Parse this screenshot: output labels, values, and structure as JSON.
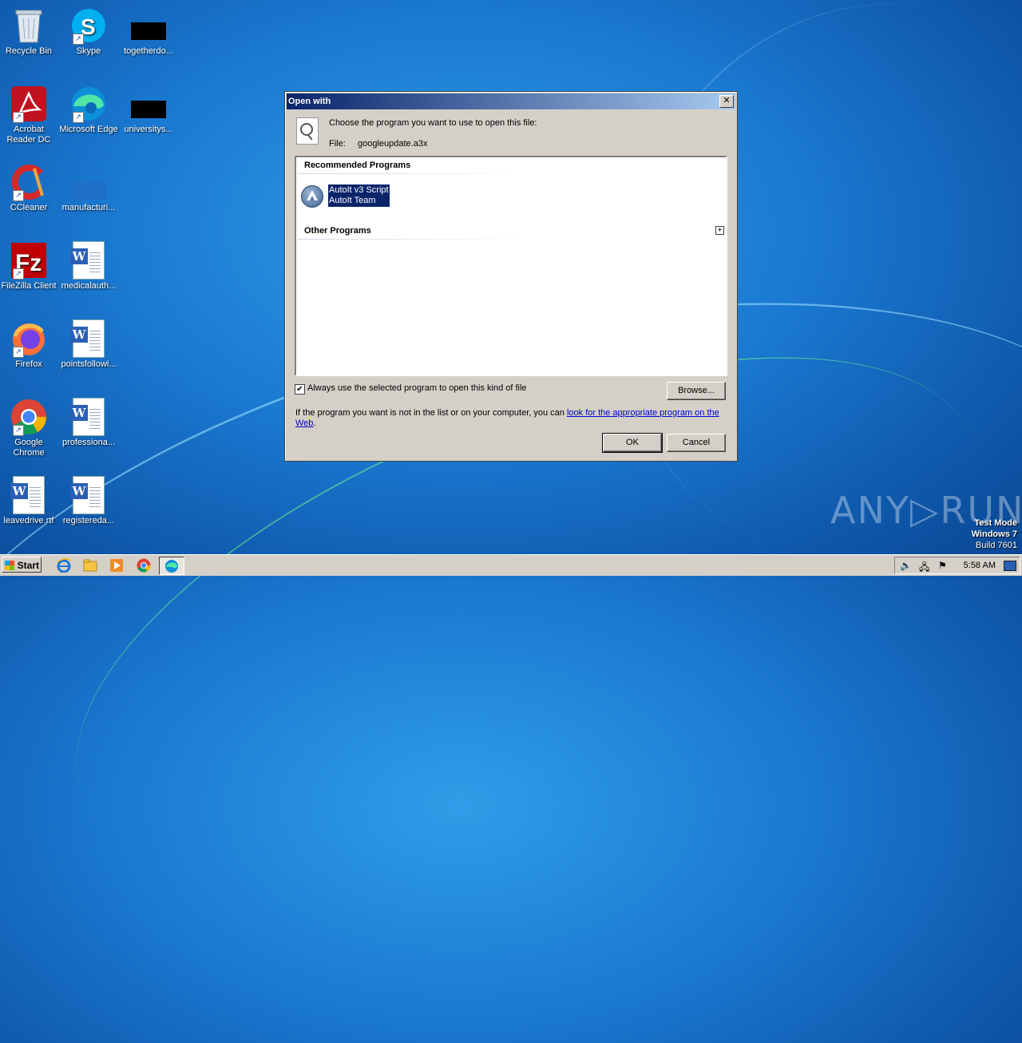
{
  "desktop": {
    "icons": [
      {
        "label": "Recycle Bin"
      },
      {
        "label": "Skype"
      },
      {
        "label": "togetherdo..."
      },
      {
        "label": "Acrobat Reader DC"
      },
      {
        "label": "Microsoft Edge"
      },
      {
        "label": "universitys..."
      },
      {
        "label": "CCleaner"
      },
      {
        "label": "manufacturi..."
      },
      {
        "label": "FileZilla Client"
      },
      {
        "label": "medicalauth..."
      },
      {
        "label": "Firefox"
      },
      {
        "label": "pointsfollowi..."
      },
      {
        "label": "Google Chrome"
      },
      {
        "label": "professiona..."
      },
      {
        "label": "leavedrive.rtf"
      },
      {
        "label": "registereda..."
      }
    ]
  },
  "dialog": {
    "title": "Open with",
    "close_glyph": "✕",
    "prompt": "Choose the program you want to use to open this file:",
    "file_label": "File:",
    "file_name": "googleupdate.a3x",
    "recommended_header": "Recommended Programs",
    "program_name": "AutoIt v3 Script",
    "program_vendor": "AutoIt Team",
    "other_header": "Other Programs",
    "expander_glyph": "+",
    "always_use_label": "Always use the selected program to open this kind of file",
    "always_use_checked": "✔",
    "browse_label": "Browse...",
    "info_text": "If the program you want is not in the list or on your computer, you can ",
    "info_link": "look for the appropriate program on the Web",
    "info_end": ".",
    "ok_label": "OK",
    "cancel_label": "Cancel"
  },
  "watermark": {
    "brand": "ANY▷RUN",
    "line1": "Test Mode",
    "line2": "Windows 7",
    "line3": "Build 7601"
  },
  "taskbar": {
    "start_label": "Start",
    "clock": "5:58 AM"
  },
  "colors": {
    "title_active": "#0a246a",
    "selection": "#0a246a",
    "link": "#0000cc"
  }
}
